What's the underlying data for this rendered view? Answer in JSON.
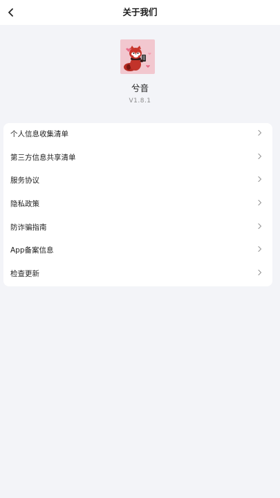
{
  "header": {
    "title": "关于我们",
    "back_icon": "chevron-left-icon"
  },
  "app": {
    "name": "兮音",
    "version": "V1.8.1",
    "logo_icon": "red-panda-logo-icon"
  },
  "menu": {
    "items": [
      {
        "label": "个人信息收集清单",
        "icon": "chevron-right-icon"
      },
      {
        "label": "第三方信息共享清单",
        "icon": "chevron-right-icon"
      },
      {
        "label": "服务协议",
        "icon": "chevron-right-icon"
      },
      {
        "label": "隐私政策",
        "icon": "chevron-right-icon"
      },
      {
        "label": "防诈骗指南",
        "icon": "chevron-right-icon"
      },
      {
        "label": "App备案信息",
        "icon": "chevron-right-icon"
      },
      {
        "label": "检查更新",
        "icon": "chevron-right-icon"
      }
    ]
  },
  "colors": {
    "background": "#f3f4f8",
    "card": "#ffffff",
    "logo_bg": "#f2c7cf",
    "chevron": "#9a9a9a"
  }
}
